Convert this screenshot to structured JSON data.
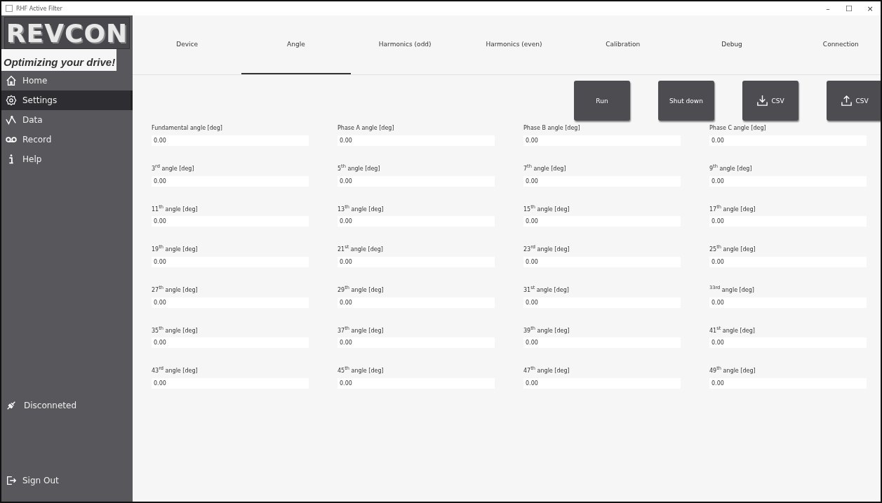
{
  "window": {
    "title": "RHF Active Filter",
    "controls": [
      "–",
      "☐",
      "×"
    ]
  },
  "logo": {
    "text": "REVCON",
    "tagline": "Optimizing your drive!"
  },
  "sidebar": {
    "items": [
      {
        "label": "Home",
        "kind": "home",
        "selected": false
      },
      {
        "label": "Settings",
        "kind": "gear",
        "selected": true
      },
      {
        "label": "Data",
        "kind": "graph",
        "selected": false
      },
      {
        "label": "Record",
        "kind": "tape",
        "selected": false
      },
      {
        "label": "Help",
        "kind": "info",
        "selected": false
      }
    ],
    "status": "Disconneted",
    "sign_out": "Sign Out"
  },
  "tabs": [
    {
      "label": "Device",
      "selected": false
    },
    {
      "label": "Angle",
      "selected": true
    },
    {
      "label": "Harmonics (odd)",
      "selected": false
    },
    {
      "label": "Harmonics (even)",
      "selected": false
    },
    {
      "label": "Calibration",
      "selected": false
    },
    {
      "label": "Debug",
      "selected": false
    },
    {
      "label": "Connection",
      "selected": false
    }
  ],
  "actions": [
    {
      "label": "Run",
      "kind": "plain"
    },
    {
      "label": "Shut down",
      "kind": "plain"
    },
    {
      "label": "CSV",
      "kind": "download"
    },
    {
      "label": "CSV",
      "kind": "upload"
    }
  ],
  "fields": [
    {
      "label": "Fundamental angle [deg]",
      "value": "0.00"
    },
    {
      "label": "Phase A angle [deg]",
      "value": "0.00"
    },
    {
      "label": "Phase B angle [deg]",
      "value": "0.00"
    },
    {
      "label": "Phase C angle [deg]",
      "value": "0.00"
    },
    {
      "label": "3$^{rd}$ angle [deg]",
      "value": "0.00"
    },
    {
      "label": "5$^{th}$ angle [deg]",
      "value": "0.00"
    },
    {
      "label": "7$^{th}$ angle [deg]",
      "value": "0.00"
    },
    {
      "label": "9$^{th}$ angle [deg]",
      "value": "0.00"
    },
    {
      "label": "11$^{th}$ angle [deg]",
      "value": "0.00"
    },
    {
      "label": "13$^{th}$ angle [deg]",
      "value": "0.00"
    },
    {
      "label": "15$^{th}$ angle [deg]",
      "value": "0.00"
    },
    {
      "label": "17$^{th}$ angle [deg]",
      "value": "0.00"
    },
    {
      "label": "19$^{th}$ angle [deg]",
      "value": "0.00"
    },
    {
      "label": "21$^{st}$ angle [deg]",
      "value": "0.00"
    },
    {
      "label": "23$^{rd}$ angle [deg]",
      "value": "0.00"
    },
    {
      "label": "25$^{th}$ angle [deg]",
      "value": "0.00"
    },
    {
      "label": "27$^{th}$ angle [deg]",
      "value": "0.00"
    },
    {
      "label": "29$^{th}$ angle [deg]",
      "value": "0.00"
    },
    {
      "label": "31$^{st}$ angle [deg]",
      "value": "0.00"
    },
    {
      "label": "$^{33rd}$ angle [deg]",
      "value": "0.00"
    },
    {
      "label": "35$^{th}$ angle [deg]",
      "value": "0.00"
    },
    {
      "label": "37$^{th}$ angle [deg]",
      "value": "0.00"
    },
    {
      "label": "39$^{th}$ angle [deg]",
      "value": "0.00"
    },
    {
      "label": "41$^{st}$ angle [deg]",
      "value": "0.00"
    },
    {
      "label": "43$^{rd}$ angle [deg]",
      "value": "0.00"
    },
    {
      "label": "45$^{th}$ angle [deg]",
      "value": "0.00"
    },
    {
      "label": "47$^{th}$ angle [deg]",
      "value": "0.00"
    },
    {
      "label": "49$^{th}$ angle [deg]",
      "value": "0.00"
    }
  ]
}
